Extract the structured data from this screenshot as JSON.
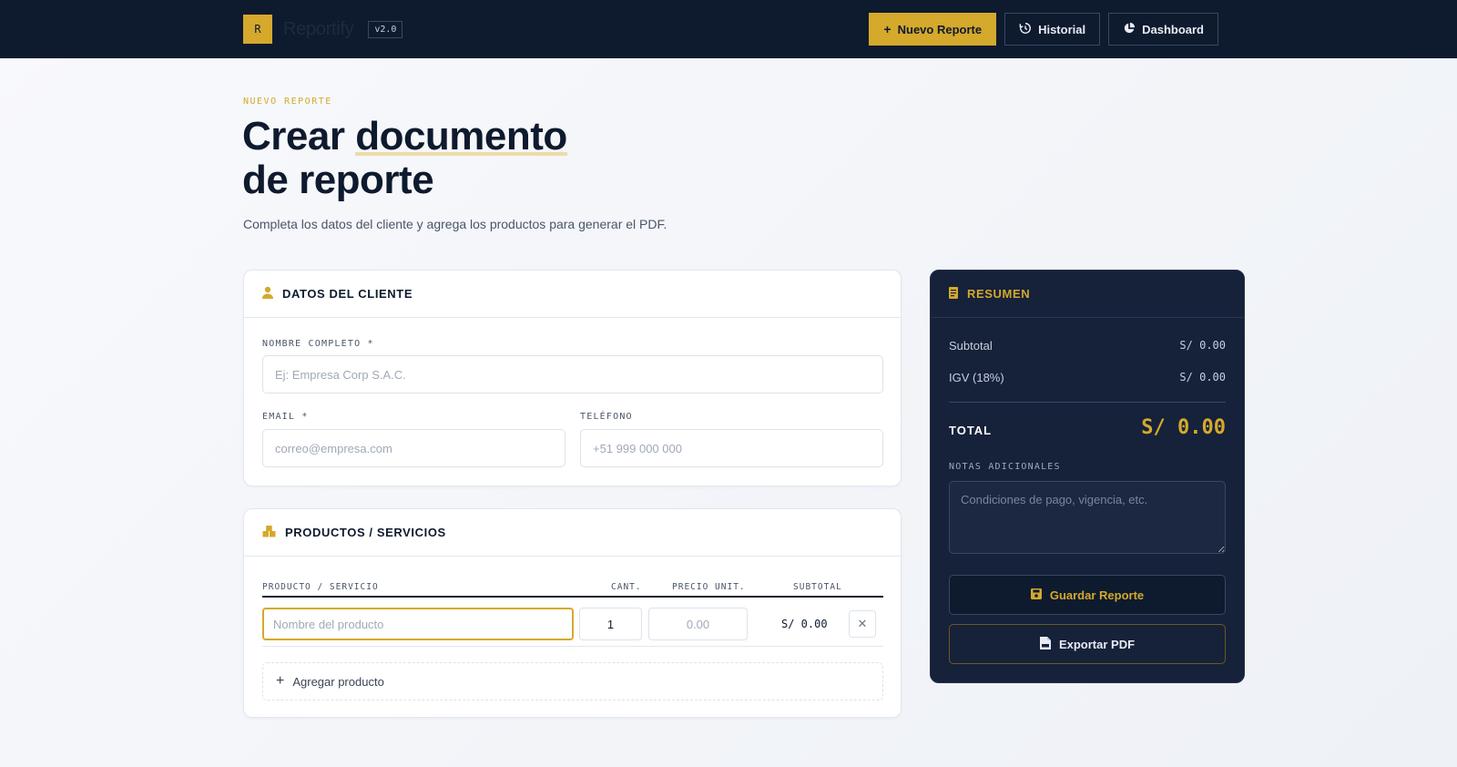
{
  "app": {
    "logo_letter": "R",
    "name": "Reportify",
    "version": "v2.0"
  },
  "nav": {
    "new_report": "Nuevo Reporte",
    "history": "Historial",
    "dashboard": "Dashboard"
  },
  "header": {
    "eyebrow": "NUEVO REPORTE",
    "title_part1": "Crear ",
    "title_highlight": "documento",
    "title_part2": "de reporte",
    "subtitle": "Completa los datos del cliente y agrega los productos para generar el PDF."
  },
  "client": {
    "title": "DATOS DEL CLIENTE",
    "name_label": "NOMBRE COMPLETO *",
    "name_placeholder": "Ej: Empresa Corp S.A.C.",
    "name_value": "",
    "email_label": "EMAIL *",
    "email_placeholder": "correo@empresa.com",
    "email_value": "",
    "phone_label": "TELÉFONO",
    "phone_placeholder": "+51 999 000 000",
    "phone_value": ""
  },
  "products": {
    "title": "PRODUCTOS / SERVICIOS",
    "columns": {
      "product": "PRODUCTO / SERVICIO",
      "qty": "CANT.",
      "unit_price": "PRECIO UNIT.",
      "subtotal": "SUBTOTAL"
    },
    "rows": [
      {
        "name_placeholder": "Nombre del producto",
        "name_value": "",
        "qty": "1",
        "price_placeholder": "0.00",
        "subtotal": "S/ 0.00"
      }
    ],
    "add_label": "Agregar producto"
  },
  "summary": {
    "title": "RESUMEN",
    "subtotal_label": "Subtotal",
    "subtotal_value": "S/ 0.00",
    "igv_label": "IGV (18%)",
    "igv_value": "S/ 0.00",
    "total_label": "TOTAL",
    "total_value": "S/ 0.00",
    "notes_label": "NOTAS ADICIONALES",
    "notes_placeholder": "Condiciones de pago, vigencia, etc.",
    "notes_value": "",
    "save_label": "Guardar Reporte",
    "export_label": "Exportar PDF"
  },
  "colors": {
    "navy": "#0e1a2e",
    "gold": "#d4a92c",
    "summary_bg": "#16213a"
  },
  "icons": {
    "new_report": "plus-icon",
    "history": "history-icon",
    "dashboard": "pie-chart-icon",
    "client": "user-icon",
    "products": "boxes-icon",
    "summary": "receipt-icon",
    "save": "floppy-disk-icon",
    "export": "pdf-file-icon",
    "delete": "close-icon",
    "add": "plus-icon"
  }
}
